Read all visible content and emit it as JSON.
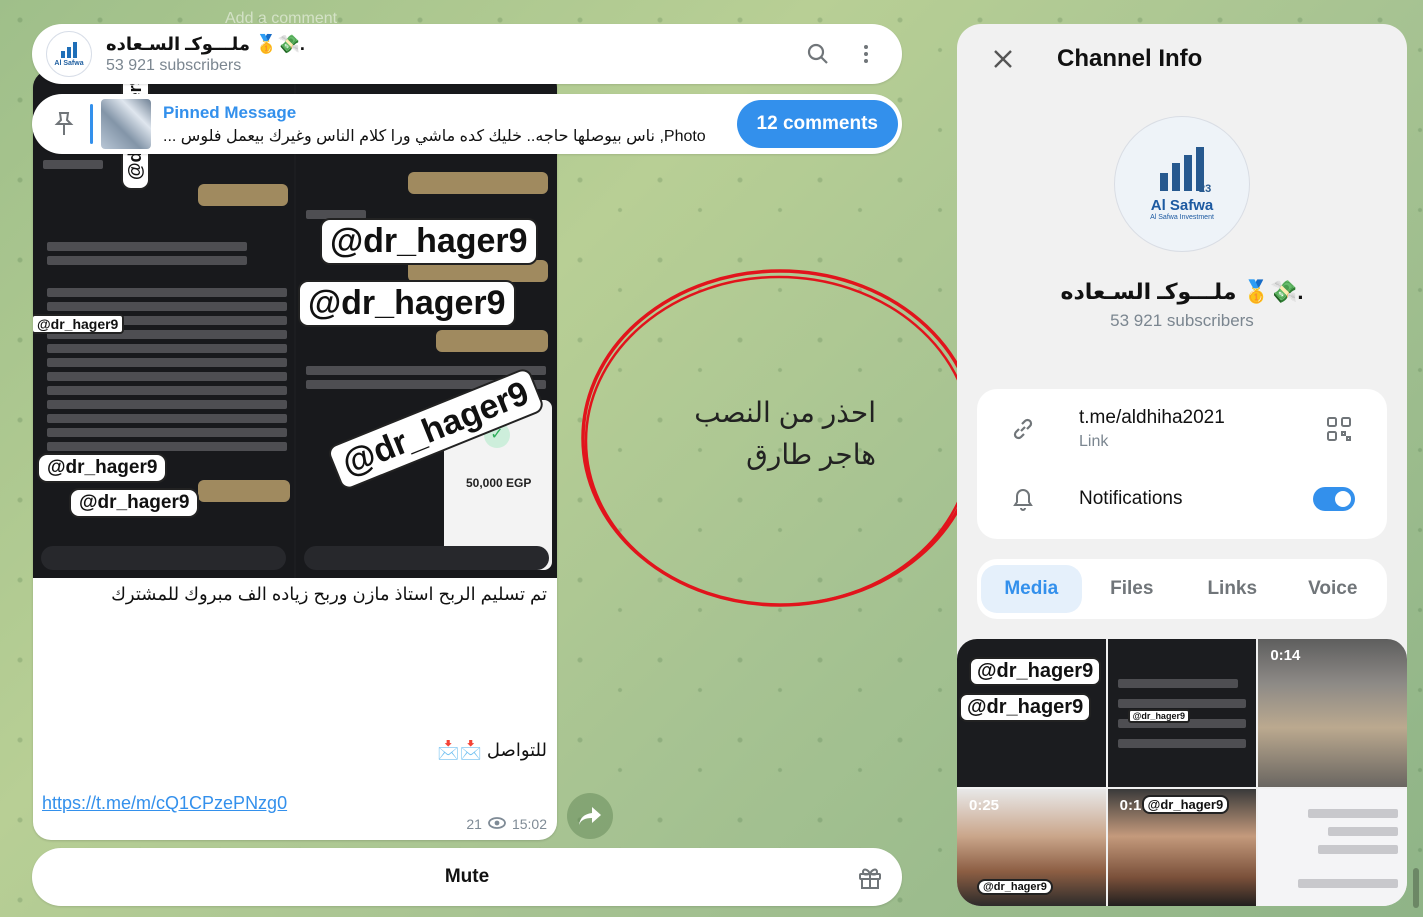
{
  "background_ghost": "Add a comment",
  "header": {
    "avatar_label": "Al Safwa",
    "title": "ملـــوكـ السـعاده 🥇💸.",
    "subscribers": "53 921 subscribers",
    "search_icon": "search-icon",
    "more_icon": "more-vertical-icon"
  },
  "pinned": {
    "title": "Pinned Message",
    "text": "Photo, ناس بيوصلها حاجه.. خليك كده ماشي ورا كلام الناس وغيرك بيعمل فلوس ...",
    "comments_label": "12 comments"
  },
  "message": {
    "watermark": "@dr_hager9",
    "egp_amount": "50,000 EGP",
    "caption": "تم تسليم الربح استاذ مازن وربح زياده الف مبروك للمشترك",
    "contact": "للتواصل 📩📩",
    "link": "https://t.me/m/cQ1CPzePNzg0",
    "views": "21",
    "time": "15:02"
  },
  "annotation": {
    "line1": "احذر من النصب",
    "line2": "هاجر طارق",
    "color": "#e1141c"
  },
  "mute": {
    "label": "Mute"
  },
  "panel": {
    "title": "Channel Info",
    "avatar_title": "Al Safwa",
    "avatar_sub": "Al Safwa Investment",
    "avatar_num": "23",
    "name": "ملـــوكـ السـعاده 🥇💸.",
    "subscribers": "53 921 subscribers",
    "link_value": "t.me/aldhiha2021",
    "link_label": "Link",
    "notifications_label": "Notifications",
    "notifications_on": true,
    "tabs": [
      "Media",
      "Files",
      "Links",
      "Voice"
    ],
    "active_tab": "Media",
    "media": [
      {
        "type": "photo",
        "watermark": "@dr_hager9"
      },
      {
        "type": "photo",
        "watermark": "@dr_hager9"
      },
      {
        "type": "video",
        "duration": "0:14"
      },
      {
        "type": "video",
        "duration": "0:25",
        "watermark": "@dr_hager9"
      },
      {
        "type": "video",
        "duration": "0:16",
        "watermark": "@dr_hager9"
      },
      {
        "type": "photo"
      }
    ]
  },
  "colors": {
    "accent": "#3390ec",
    "link": "#3390ec"
  }
}
